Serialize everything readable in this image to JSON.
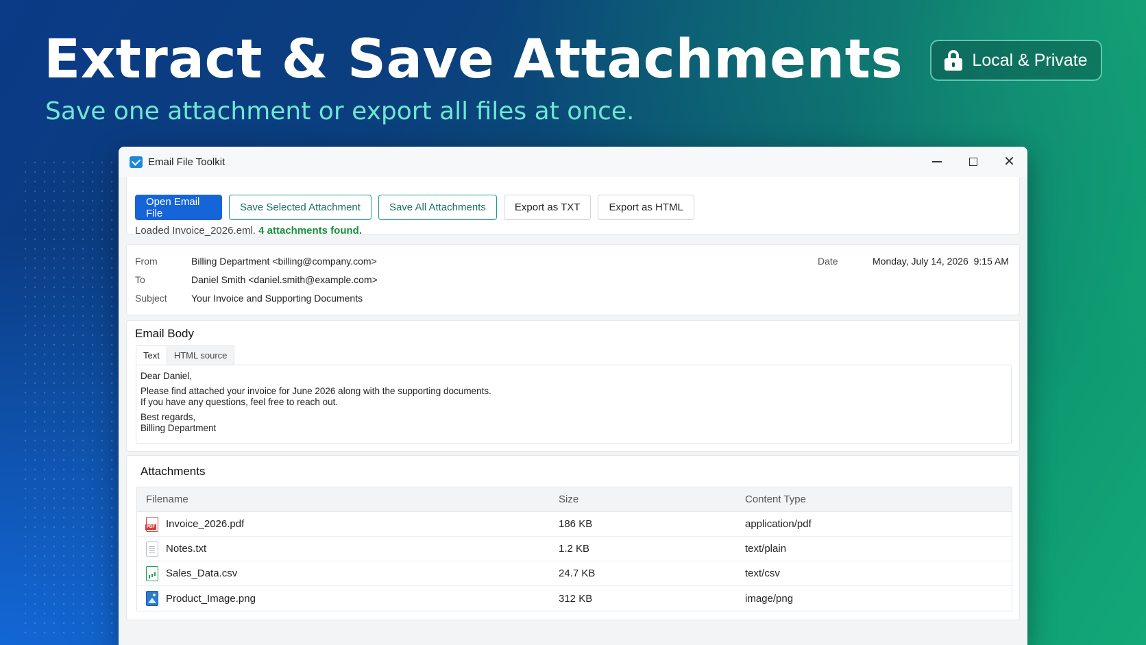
{
  "hero": {
    "title": "Extract & Save Attachments",
    "subtitle": "Save one attachment or export all files at once.",
    "badge_label": "Local & Private",
    "badge_icon": "lock-icon"
  },
  "window": {
    "title": "Email File Toolkit",
    "app_icon": "mail-icon"
  },
  "toolbar": {
    "open_label": "Open Email File",
    "save_selected_label": "Save Selected Attachment",
    "save_all_label": "Save All Attachments",
    "export_txt_label": "Export as TXT",
    "export_html_label": "Export as HTML"
  },
  "status": {
    "loaded": "Loaded Invoice_2026.eml.",
    "found": "4 attachments found."
  },
  "email": {
    "from_label": "From",
    "from_value": "Billing Department <billing@company.com>",
    "to_label": "To",
    "to_value": "Daniel Smith <daniel.smith@example.com>",
    "subject_label": "Subject",
    "subject_value": "Your Invoice and Supporting Documents",
    "date_label": "Date",
    "date_value": "Monday, July 14, 2026  9:15 AM"
  },
  "body": {
    "title": "Email Body",
    "tabs": [
      "Text",
      "HTML source"
    ],
    "lines": [
      "Dear Daniel,",
      "Please find attached your invoice for June 2026 along with the supporting documents.",
      "If you have any questions, feel free to reach out.",
      "Best regards,",
      "Billing Department"
    ]
  },
  "attachments": {
    "title": "Attachments",
    "columns": [
      "Filename",
      "Size",
      "Content Type"
    ],
    "rows": [
      {
        "icon": "pdf-file-icon",
        "filename": "Invoice_2026.pdf",
        "size": "186 KB",
        "type": "application/pdf"
      },
      {
        "icon": "text-file-icon",
        "filename": "Notes.txt",
        "size": "1.2 KB",
        "type": "text/plain"
      },
      {
        "icon": "csv-file-icon",
        "filename": "Sales_Data.csv",
        "size": "24.7 KB",
        "type": "text/csv"
      },
      {
        "icon": "image-file-icon",
        "filename": "Product_Image.png",
        "size": "312 KB",
        "type": "image/png"
      }
    ]
  },
  "colors": {
    "primary": "#1565d8",
    "teal": "#1e9a8a",
    "success": "#18913d",
    "subtitle": "#6ee7d3"
  }
}
